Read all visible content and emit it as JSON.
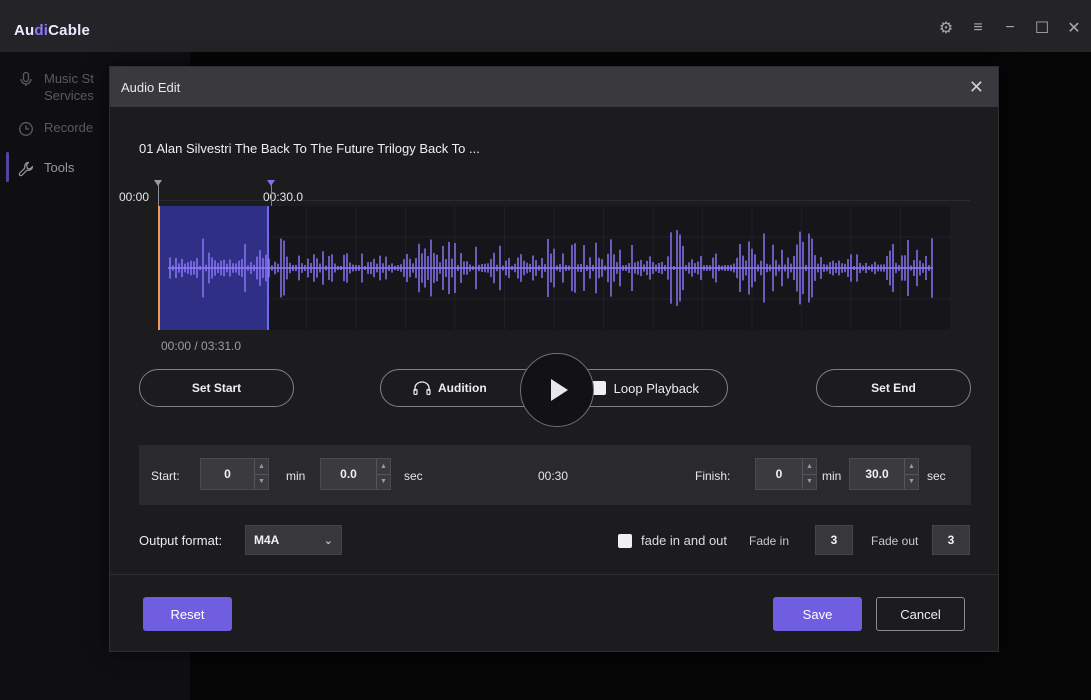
{
  "app": {
    "brand_prefix": "Au",
    "brand_accent": "di",
    "brand_suffix": "Cable",
    "accent_color": "#7b6cf6"
  },
  "window_controls": {
    "settings": "⚙",
    "menu": "≡",
    "minimize": "−",
    "maximize": "☐",
    "close": "✕"
  },
  "sidebar": {
    "items": [
      {
        "label_line1": "Music St",
        "label_line2": "Services",
        "icon": "microphone-icon"
      },
      {
        "label_line1": "Recorde",
        "icon": "clock-icon"
      },
      {
        "label_line1": "Tools",
        "icon": "wrench-icon",
        "active": true
      }
    ]
  },
  "dialog": {
    "title": "Audio Edit",
    "close": "✕",
    "track_title": "01 Alan Silvestri The Back To The Future Trilogy Back To ...",
    "timeline": {
      "start_label": "00:00",
      "end_label": "00:30.0"
    },
    "time_readout": "00:00 / 03:31.0",
    "set_start": "Set Start",
    "audition": "Audition",
    "loop_playback": "Loop Playback",
    "set_end": "Set End",
    "range": {
      "start_label": "Start:",
      "start_min": "0",
      "min_unit": "min",
      "start_sec": "0.0",
      "sec_unit": "sec",
      "duration": "00:30",
      "finish_label": "Finish:",
      "finish_min": "0",
      "finish_sec": "30.0"
    },
    "output": {
      "label": "Output format:",
      "format": "M4A",
      "fade_checkbox": "fade in and out",
      "fade_in_label": "Fade in",
      "fade_in_value": "3",
      "fade_out_label": "Fade out",
      "fade_out_value": "3"
    },
    "buttons": {
      "reset": "Reset",
      "save": "Save",
      "cancel": "Cancel"
    }
  },
  "waveform": {
    "selection_fraction": 0.14,
    "wave_color": "#8f7bff",
    "selection_color": "#2e2f85",
    "start_marker_color": "#f09a55"
  }
}
